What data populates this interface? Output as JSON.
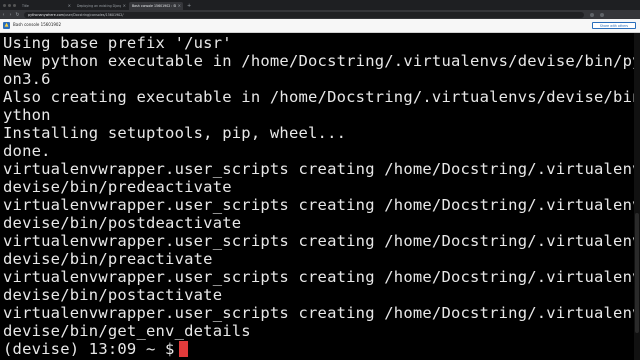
{
  "browser": {
    "tabs": [
      {
        "label": "Title",
        "active": false
      },
      {
        "label": "Deploying an existing Django …",
        "active": false
      },
      {
        "label": "Bash console 15601902 : Stri…",
        "active": true
      }
    ],
    "url_host": "pythonanywhere.com",
    "url_path": "/user/Docstring/consoles/15601902/"
  },
  "app": {
    "console_title": "Bash console 15601902",
    "share_label": "Share with others"
  },
  "terminal": {
    "lines": [
      "Using base prefix '/usr'",
      "New python executable in /home/Docstring/.virtualenvs/devise/bin/pyth",
      "on3.6",
      "Also creating executable in /home/Docstring/.virtualenvs/devise/bin/p",
      "ython",
      "Installing setuptools, pip, wheel...",
      "done.",
      "virtualenvwrapper.user_scripts creating /home/Docstring/.virtualenvs/",
      "devise/bin/predeactivate",
      "virtualenvwrapper.user_scripts creating /home/Docstring/.virtualenvs/",
      "devise/bin/postdeactivate",
      "virtualenvwrapper.user_scripts creating /home/Docstring/.virtualenvs/",
      "devise/bin/preactivate",
      "virtualenvwrapper.user_scripts creating /home/Docstring/.virtualenvs/",
      "devise/bin/postactivate",
      "virtualenvwrapper.user_scripts creating /home/Docstring/.virtualenvs/",
      "devise/bin/get_env_details"
    ],
    "prompt": "(devise) 13:09 ~ $",
    "cursor_color": "#e03b3b"
  }
}
